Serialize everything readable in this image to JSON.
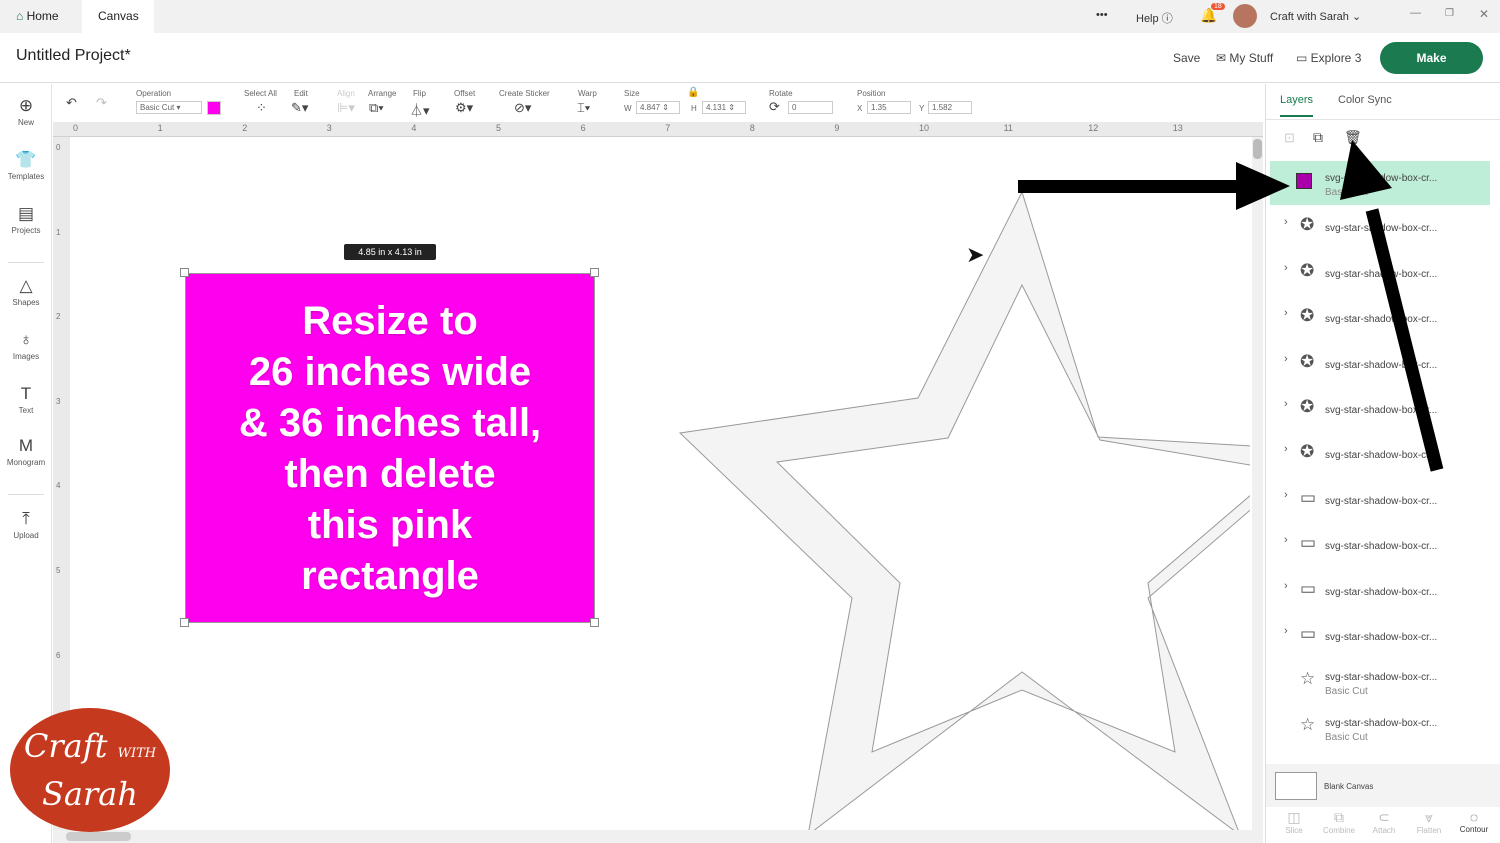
{
  "topbar": {
    "home": "Home",
    "canvas": "Canvas",
    "more": "•••",
    "help": "Help",
    "notifications": "18",
    "user": "Craft with Sarah"
  },
  "header": {
    "title": "Untitled Project*",
    "save": "Save",
    "mystuff": "My Stuff",
    "machine": "Explore 3",
    "make": "Make"
  },
  "leftbar": [
    {
      "label": "New",
      "icon": "⊕"
    },
    {
      "label": "Templates",
      "icon": "👕"
    },
    {
      "label": "Projects",
      "icon": "▤"
    },
    {
      "label": "Shapes",
      "icon": "△"
    },
    {
      "label": "Images",
      "icon": "♁"
    },
    {
      "label": "Text",
      "icon": "T"
    },
    {
      "label": "Monogram",
      "icon": "M"
    },
    {
      "label": "Upload",
      "icon": "⤒"
    }
  ],
  "toolbar": {
    "operation_label": "Operation",
    "operation": "Basic Cut",
    "select_all": "Select All",
    "edit": "Edit",
    "align": "Align",
    "arrange": "Arrange",
    "flip": "Flip",
    "offset": "Offset",
    "create_sticker": "Create Sticker",
    "warp": "Warp",
    "size": "Size",
    "w_label": "W",
    "w": "4.847",
    "h_label": "H",
    "h": "4.131",
    "rotate": "Rotate",
    "rotate_val": "0",
    "position": "Position",
    "x_label": "X",
    "x": "1.35",
    "y_label": "Y",
    "y": "1.582",
    "color": "#ff00ee"
  },
  "ruler_h": [
    "0",
    "1",
    "2",
    "3",
    "4",
    "5",
    "6",
    "7",
    "8",
    "9",
    "10",
    "11",
    "12",
    "13"
  ],
  "ruler_v": [
    "0",
    "1",
    "2",
    "3",
    "4",
    "5",
    "6"
  ],
  "canvas": {
    "dimension": "4.85  in x 4.13  in",
    "rect_text": [
      "Resize to",
      "26 inches wide",
      "& 36 inches tall,",
      "then delete",
      "this pink",
      "rectangle"
    ]
  },
  "panel": {
    "tabs": [
      "Layers",
      "Color Sync"
    ],
    "layers": [
      {
        "name": "svg-star-shadow-box-cr...",
        "sub": "Basic Cut",
        "selected": true
      },
      {
        "name": "svg-star-shadow-box-cr...",
        "group": true,
        "icon": "✪"
      },
      {
        "name": "svg-star-shadow-box-cr...",
        "group": true,
        "icon": "✪"
      },
      {
        "name": "svg-star-shadow-box-cr...",
        "group": true,
        "icon": "✪"
      },
      {
        "name": "svg-star-shadow-box-cr...",
        "group": true,
        "icon": "✪"
      },
      {
        "name": "svg-star-shadow-box-cr...",
        "group": true,
        "icon": "✪"
      },
      {
        "name": "svg-star-shadow-box-cr...",
        "group": true,
        "icon": "✪"
      },
      {
        "name": "svg-star-shadow-box-cr...",
        "group": true,
        "icon": "▭"
      },
      {
        "name": "svg-star-shadow-box-cr...",
        "group": true,
        "icon": "▭"
      },
      {
        "name": "svg-star-shadow-box-cr...",
        "group": true,
        "icon": "▭"
      },
      {
        "name": "svg-star-shadow-box-cr...",
        "group": true,
        "icon": "▭"
      },
      {
        "name": "svg-star-shadow-box-cr...",
        "sub": "Basic Cut",
        "icon": "☆"
      },
      {
        "name": "svg-star-shadow-box-cr...",
        "sub": "Basic Cut",
        "icon": "☆"
      }
    ],
    "blank_canvas": "Blank Canvas",
    "bottom": [
      {
        "label": "Slice",
        "icon": "◫"
      },
      {
        "label": "Combine",
        "icon": "⧉"
      },
      {
        "label": "Attach",
        "icon": "⊂"
      },
      {
        "label": "Flatten",
        "icon": "⩔"
      },
      {
        "label": "Contour",
        "icon": "◌"
      }
    ]
  },
  "logo": {
    "text": "Craft with Sarah"
  }
}
